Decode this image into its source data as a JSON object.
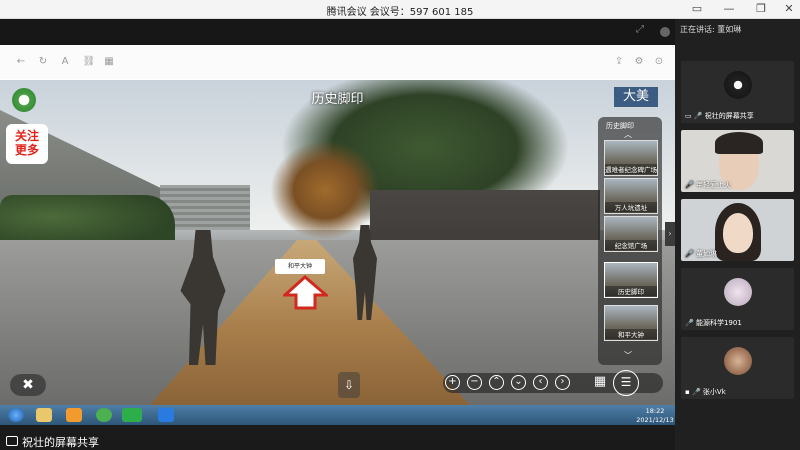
{
  "titlebar": {
    "title": "腾讯会议 会议号：597 601 185",
    "controls": [
      "▭",
      "—",
      "❐",
      "✕"
    ]
  },
  "scene": {
    "title": "历史脚印",
    "follow_badge": "关注\n更多",
    "brand_badge": "大美",
    "location_marker": "和平大钟",
    "thumb_header": "历史脚印",
    "thumbnails": [
      {
        "label": "遇难者纪念碑广场"
      },
      {
        "label": "万人坑遗址"
      },
      {
        "label": "纪念馆广场"
      },
      {
        "label": "历史脚印"
      },
      {
        "label": "和平大钟"
      }
    ],
    "nav_controls": [
      "+",
      "−",
      "⌃",
      "⌄",
      "‹",
      "›"
    ],
    "vr_icon": "vr-icon",
    "download_icon": "download-icon"
  },
  "taskbar": {
    "time": "18:22",
    "date": "2021/12/13"
  },
  "sharing_bar": {
    "label": "祝壮的屏幕共享"
  },
  "participants_panel": {
    "speaking_label": "正在讲话: 董如琳",
    "participants": [
      {
        "name": "祝壮的屏幕共享",
        "type": "screen-share"
      },
      {
        "name": "年轻爱上火",
        "type": "camera"
      },
      {
        "name": "董如琳",
        "type": "camera"
      },
      {
        "name": "能源科学1901",
        "type": "avatar"
      },
      {
        "name": "张小Vk",
        "type": "avatar"
      }
    ]
  }
}
